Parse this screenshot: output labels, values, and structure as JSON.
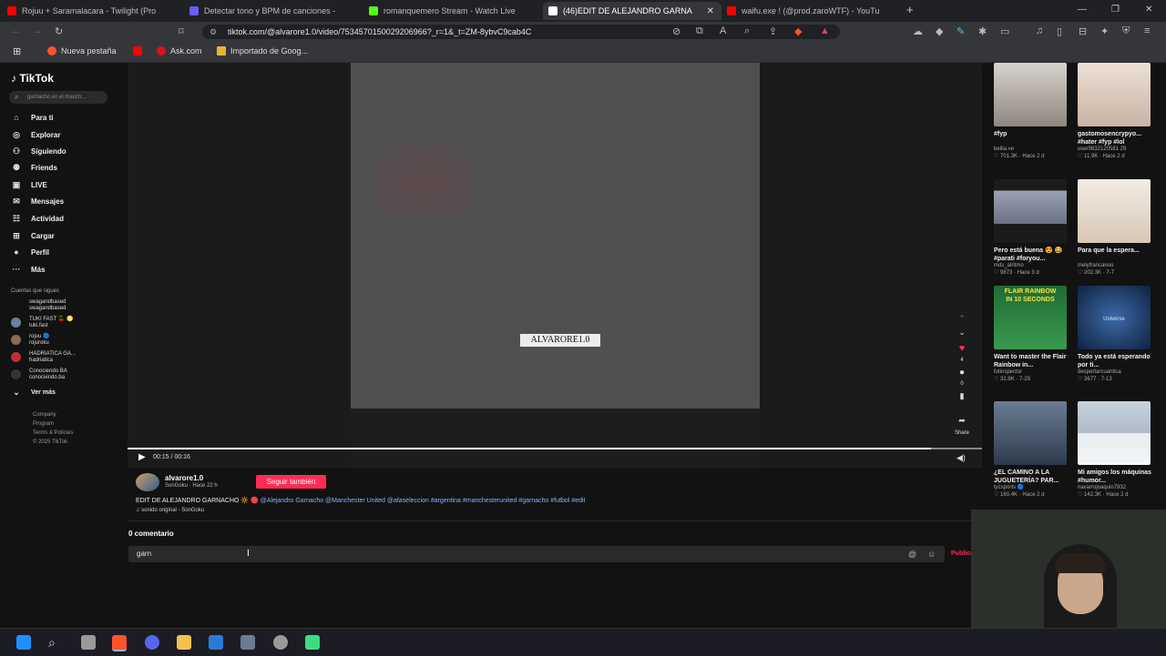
{
  "browser": {
    "tabs": [
      {
        "title": "Rojuu + Saramalacara - Twilight (Pro",
        "favicon_color": "#ff0000"
      },
      {
        "title": "Detectar tono y BPM de canciones -",
        "favicon_color": "#6b5cff"
      },
      {
        "title": "romanquemero Stream - Watch Live",
        "favicon_color": "#53fc18"
      },
      {
        "title": "(46)EDIT DE ALEJANDRO GARNA",
        "favicon_color": "#ffffff"
      },
      {
        "title": "waifu.exe ! (@prod.zaroWTF) - YouTu",
        "favicon_color": "#ff0000"
      }
    ],
    "active_tab_close": "✕",
    "new_tab": "+",
    "window_controls": {
      "minimize": "—",
      "maximize": "❐",
      "close": "✕"
    },
    "url": "tiktok.com/@alvarore1.0/video/7534570150029206966?_r=1&_t=ZM-8ybvC9cab4C",
    "bookmarks": [
      {
        "label": "Nueva pestaña",
        "icon_color": "#fb542b"
      },
      {
        "label": "",
        "icon_color": "#ff0000"
      },
      {
        "label": "Ask.com",
        "icon_color": "#e0101b"
      },
      {
        "label": "Importado de Goog...",
        "icon_color": "#e8b634"
      }
    ]
  },
  "sidebar": {
    "logo": "TikTok",
    "search_placeholder": "garnacho en el manch...",
    "nav": [
      {
        "label": "Para ti",
        "icon": "home-icon",
        "glyph": "⌂"
      },
      {
        "label": "Explorar",
        "icon": "compass-icon",
        "glyph": "◎"
      },
      {
        "label": "Siguiendo",
        "icon": "following-icon",
        "glyph": "⚇"
      },
      {
        "label": "Friends",
        "icon": "friends-icon",
        "glyph": "⚉"
      },
      {
        "label": "LIVE",
        "icon": "live-icon",
        "glyph": "▣"
      },
      {
        "label": "Mensajes",
        "icon": "messages-icon",
        "glyph": "✉"
      },
      {
        "label": "Actividad",
        "icon": "activity-icon",
        "glyph": "☷"
      },
      {
        "label": "Cargar",
        "icon": "upload-icon",
        "glyph": "⊞"
      },
      {
        "label": "Perfil",
        "icon": "profile-icon",
        "glyph": "●"
      },
      {
        "label": "Más",
        "icon": "more-icon",
        "glyph": "···"
      }
    ],
    "following_heading": "Cuentas que sigues",
    "following": [
      {
        "name": "swagandbased",
        "handle": "swagandbased"
      },
      {
        "name": "TUKI FAST 🍒 ♋",
        "handle": "tuki.fast"
      },
      {
        "name": "rojuu 🔵",
        "handle": "rojuroku"
      },
      {
        "name": "HADRIATICA GA...",
        "handle": "hadriatica"
      },
      {
        "name": "Conociendo BA",
        "handle": "conociendo.ba"
      }
    ],
    "see_more": "Ver más",
    "footer": [
      "Company",
      "Program",
      "Terms & Policies",
      "© 2025 TikTok"
    ]
  },
  "video": {
    "watermark": "ALVARORE1.0",
    "time": "00:15 / 00:16",
    "progress": 0.94,
    "likes": "4",
    "comments": "0",
    "share_label": "Share"
  },
  "post": {
    "username": "alvarore1.0",
    "subline": "SonGoku · Hace 22 h",
    "follow_button": "Seguir también",
    "caption_lead": "EDIT DE ALEJANDRO GARNACHO 🔆 🔴",
    "caption_tags": "@Alejandro Garnacho @Manchester United @afaseleccion #argentina #manchesterunited #garnacho #futbol #edit",
    "sound": "♫ sonido original - SonGoku",
    "comments_count": "0 comentario",
    "comment_draft": "garn",
    "publish_label": "Publicar"
  },
  "recommended": [
    {
      "title": "#fyp",
      "user": "bellia.ve",
      "stats": "♡ 701.3K · Hace 2 d",
      "color": "#9a8f86"
    },
    {
      "title": "gastomosencrypyo... #hater #fyp #lol",
      "user": "user9832120581 29",
      "stats": "♡ 11.9K · Hace 2 d",
      "color": "#d9c4b8"
    },
    {
      "title": "Pero está buena 😍 😂 #parati #foryou...",
      "user": "mds_alritmo",
      "stats": "♡ 9873 · Hace 3 d",
      "color": "#8b8fa0"
    },
    {
      "title": "Para que la espera...",
      "user": "melyfrancanoo",
      "stats": "♡ 202.3K · 7-7",
      "color": "#e7ddd0"
    },
    {
      "title": "Want to master the Flair Rainbow in...",
      "user": "futinspector",
      "stats": "♡ 32.8K · 7-25",
      "color": "#2c7a3e"
    },
    {
      "title": "Todo ya está esperando por ti...",
      "user": "despertarcuantica",
      "stats": "♡ 3677 · 7-13",
      "color": "#1f3f6b"
    },
    {
      "title": "¿EL CAMINO A LA JUGUETERÍA? PAR...",
      "user": "tycsports 🔵",
      "stats": "♡ 160.4K · Hace 2 d",
      "color": "#45566b"
    },
    {
      "title": "Mi amigos los máquinas #humor...",
      "user": "navarrojoaquin7932",
      "stats": "♡ 142.3K · Hace 2 d",
      "color": "#b8c0c8"
    }
  ],
  "rec_thumb_text": {
    "flair_line1": "FLAIR RAINBOW",
    "flair_line2": "IN 10 SECONDS",
    "universe": "Universe"
  },
  "taskbar": {
    "apps": [
      {
        "name": "windows-start-icon",
        "color": "#1e90ff"
      },
      {
        "name": "search-icon",
        "color": "#cfcfcf"
      },
      {
        "name": "task-view-icon",
        "color": "#9a9a9a"
      },
      {
        "name": "brave-icon",
        "color": "#fb542b"
      },
      {
        "name": "discord-icon",
        "color": "#5865f2"
      },
      {
        "name": "folder-icon",
        "color": "#f2c14e"
      },
      {
        "name": "store-icon",
        "color": "#2b7bd6"
      },
      {
        "name": "calculator-icon",
        "color": "#6b7c93"
      },
      {
        "name": "obs-icon",
        "color": "#9a9a9a"
      },
      {
        "name": "android-icon",
        "color": "#3ddc84"
      }
    ]
  }
}
